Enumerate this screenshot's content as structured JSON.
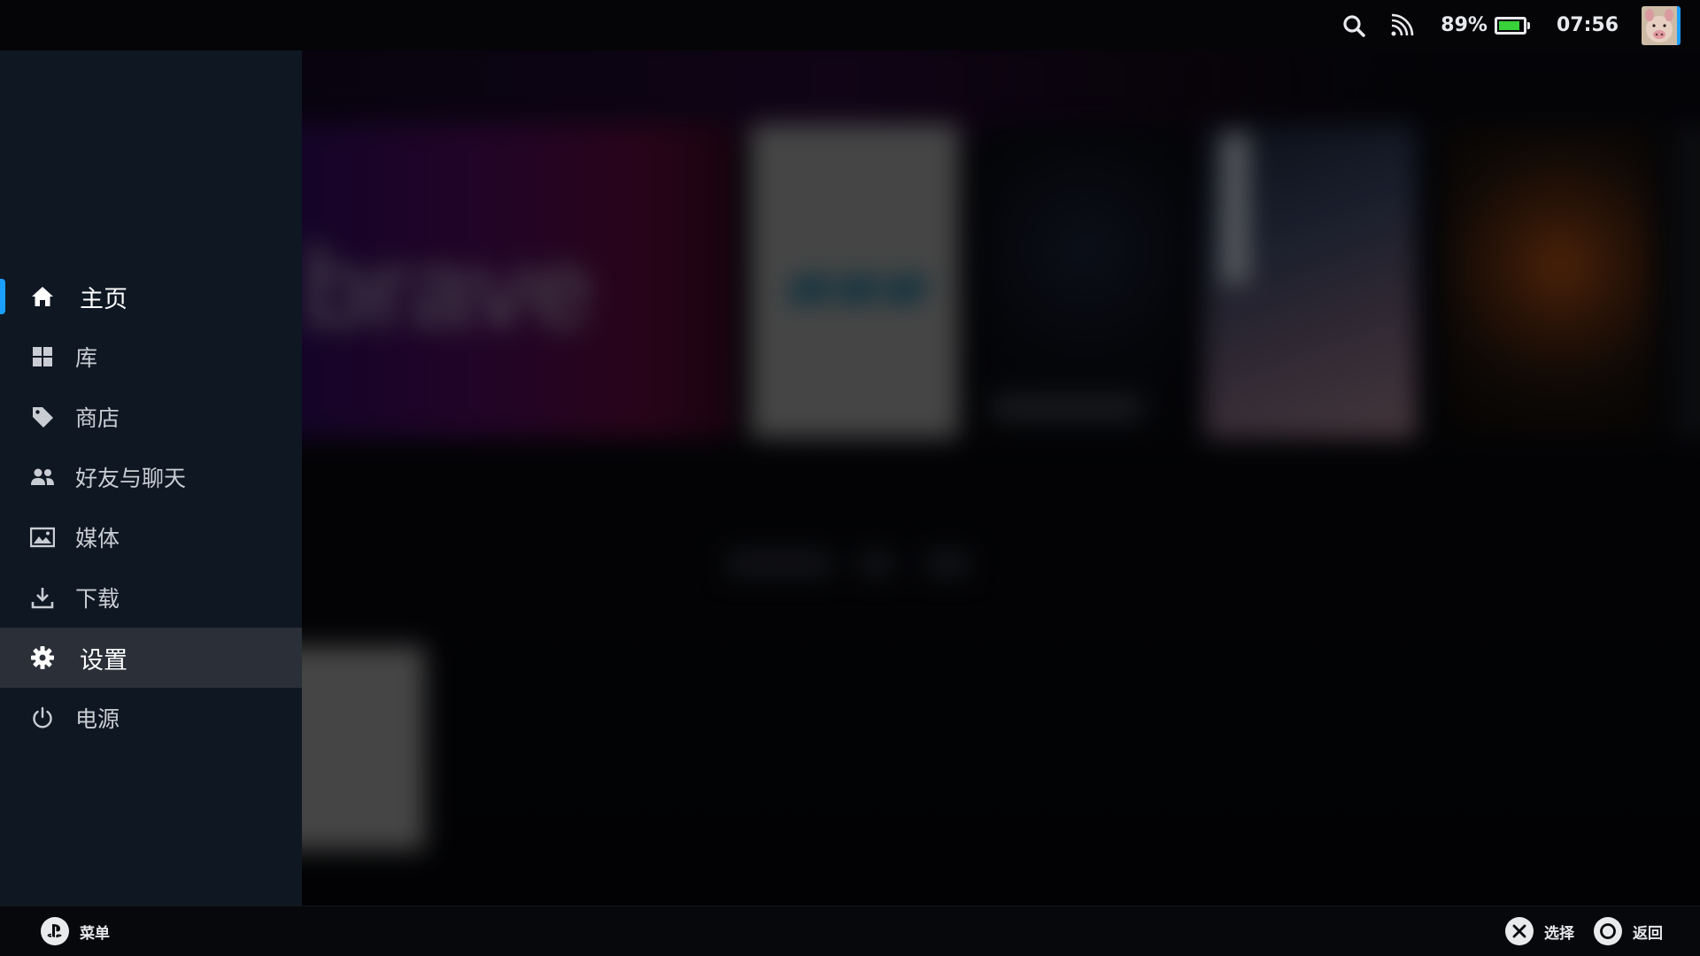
{
  "status_bar": {
    "battery_percent": "89%",
    "battery_level": 0.89,
    "time": "07:56",
    "icons": [
      "search-icon",
      "cast-icon",
      "battery-icon",
      "avatar"
    ],
    "battery_color": "#39d13a",
    "accent": "#1a9fff"
  },
  "background": {
    "hero_tile_text": "brave"
  },
  "menu": {
    "items": [
      {
        "label": "主页",
        "icon": "home-icon",
        "state": "active"
      },
      {
        "label": "库",
        "icon": "library-grid-icon",
        "state": "normal"
      },
      {
        "label": "商店",
        "icon": "store-tag-icon",
        "state": "normal"
      },
      {
        "label": "好友与聊天",
        "icon": "friends-icon",
        "state": "normal"
      },
      {
        "label": "媒体",
        "icon": "media-image-icon",
        "state": "normal"
      },
      {
        "label": "下载",
        "icon": "download-icon",
        "state": "normal"
      },
      {
        "label": "设置",
        "icon": "gear-icon",
        "state": "focused"
      },
      {
        "label": "电源",
        "icon": "power-icon",
        "state": "normal"
      }
    ]
  },
  "bottom_bar": {
    "menu_label": "菜单",
    "select_label": "选择",
    "back_label": "返回",
    "menu_icon": "playstation-icon",
    "select_icon": "cross-button-icon",
    "back_icon": "circle-button-icon"
  }
}
